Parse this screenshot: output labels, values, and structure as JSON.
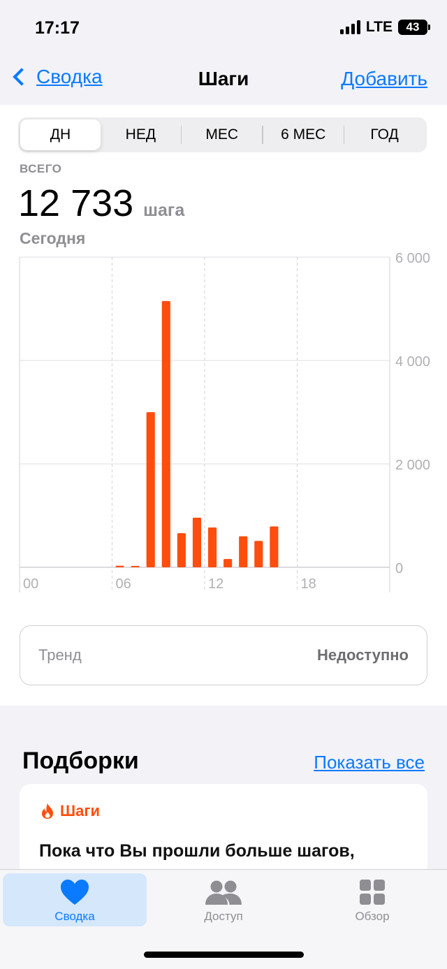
{
  "status_bar": {
    "time": "17:17",
    "network": "LTE",
    "battery": "43"
  },
  "nav": {
    "back_label": "Сводка",
    "title": "Шаги",
    "add_label": "Добавить"
  },
  "segments": [
    {
      "label": "ДН",
      "active": true
    },
    {
      "label": "НЕД",
      "active": false
    },
    {
      "label": "МЕС",
      "active": false
    },
    {
      "label": "6 МЕС",
      "active": false
    },
    {
      "label": "ГОД",
      "active": false
    }
  ],
  "summary": {
    "total_label": "ВСЕГО",
    "total_value": "12 733",
    "unit": "шага",
    "date": "Сегодня"
  },
  "chart_data": {
    "type": "bar",
    "x": [
      0,
      1,
      2,
      3,
      4,
      5,
      6,
      7,
      8,
      9,
      10,
      11,
      12,
      13,
      14,
      15,
      16,
      17,
      18,
      19,
      20,
      21,
      22,
      23
    ],
    "x_tick_labels": [
      {
        "hour": 0,
        "label": "00"
      },
      {
        "hour": 6,
        "label": "06"
      },
      {
        "hour": 12,
        "label": "12"
      },
      {
        "hour": 18,
        "label": "18"
      }
    ],
    "values": [
      0,
      0,
      0,
      0,
      0,
      0,
      30,
      20,
      3000,
      5150,
      660,
      960,
      770,
      160,
      600,
      510,
      790,
      0,
      0,
      0,
      0,
      0,
      0,
      0
    ],
    "y_ticks": [
      {
        "value": 6000,
        "label": "6 000"
      },
      {
        "value": 4000,
        "label": "4 000"
      },
      {
        "value": 2000,
        "label": "2 000"
      },
      {
        "value": 0,
        "label": "0"
      }
    ],
    "ylim": [
      0,
      6000
    ],
    "color": "#ff4d0d"
  },
  "trend": {
    "label": "Тренд",
    "value": "Недоступно"
  },
  "highlights": {
    "title": "Подборки",
    "show_all": "Показать все",
    "card": {
      "category": "Шаги",
      "icon": "flame-icon",
      "text": "Пока что Вы прошли больше шагов,"
    }
  },
  "tabs": [
    {
      "label": "Сводка",
      "icon": "heart-icon",
      "active": true
    },
    {
      "label": "Доступ",
      "icon": "people-icon",
      "active": false
    },
    {
      "label": "Обзор",
      "icon": "grid-icon",
      "active": false
    }
  ],
  "colors": {
    "accent": "#0a7aff",
    "bar": "#ff4d0d",
    "active_tab_bg": "#d4e7fb"
  }
}
